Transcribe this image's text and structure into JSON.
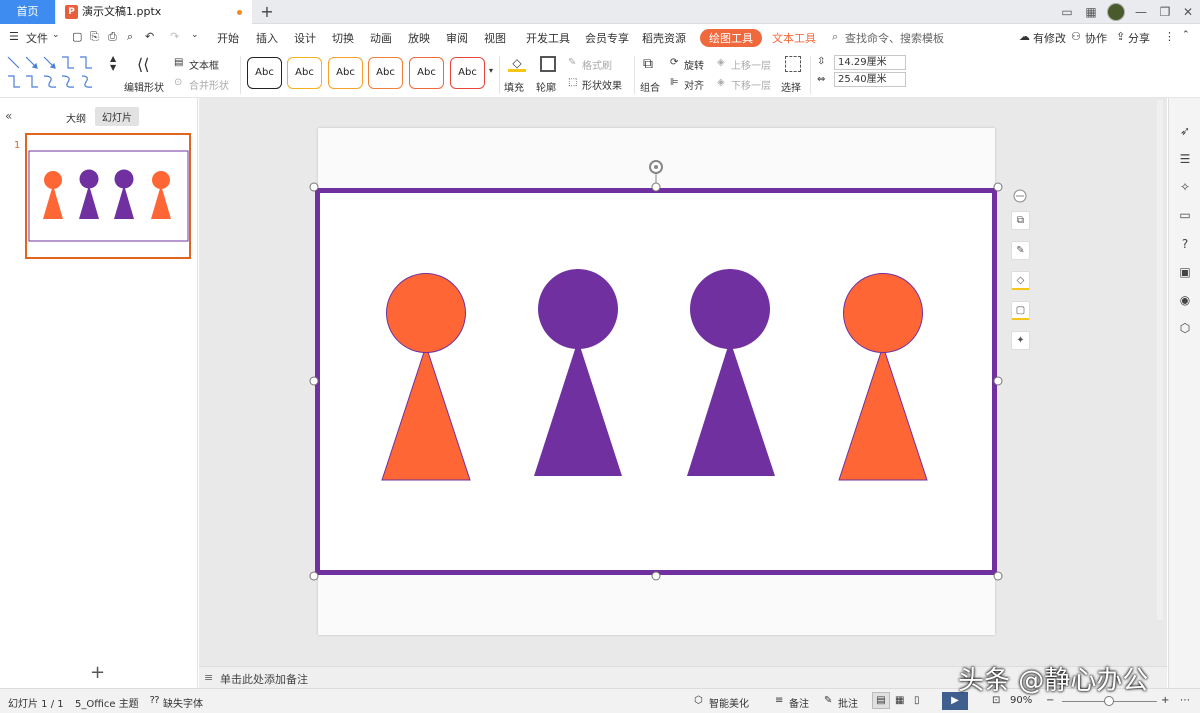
{
  "titlebar": {
    "home_tab": "首页",
    "doc_tab": "演示文稿1.pptx",
    "doc_icon": "P",
    "new_tab": "+"
  },
  "menu": {
    "file": "文件",
    "tabs": [
      "开始",
      "插入",
      "设计",
      "切换",
      "动画",
      "放映",
      "审阅",
      "视图",
      "开发工具",
      "会员专享",
      "稻壳资源",
      "绘图工具",
      "文本工具"
    ],
    "search_placeholder": "查找命令、搜索模板",
    "right_items": [
      "有修改",
      "协作",
      "分享"
    ]
  },
  "toolbar": {
    "edit_shape": "编辑形状",
    "textbox": "文本框",
    "merge_shape": "合并形状",
    "style_sample": "Abc",
    "style_borders": [
      "#222222",
      "#f5b120",
      "#f5a32a",
      "#f0813a",
      "#ee6a3c",
      "#e8463c"
    ],
    "fill": "填充",
    "outline": "轮廓",
    "format_brush": "格式刷",
    "shape_effect": "形状效果",
    "group": "组合",
    "rotate": "旋转",
    "align": "对齐",
    "bring_forward": "上移一层",
    "send_backward": "下移一层",
    "select": "选择",
    "height": "14.29厘米",
    "width": "25.40厘米"
  },
  "left_panel": {
    "outline_tab": "大纲",
    "slides_tab": "幻灯片",
    "slide_number": "1",
    "add": "+"
  },
  "notes": {
    "placeholder": "单击此处添加备注"
  },
  "status": {
    "slide_info": "幻灯片 1 / 1",
    "theme": "5_Office 主题",
    "missing_font": "缺失字体",
    "smart_beautify": "智能美化",
    "notes": "备注",
    "comments": "批注",
    "zoom": "90%"
  },
  "watermark": "头条 @静心办公",
  "slide_content": {
    "colors": {
      "orange": "#ff6635",
      "purple": "#7030a0",
      "frame": "#7030a0",
      "accent": "#f0693d"
    }
  }
}
